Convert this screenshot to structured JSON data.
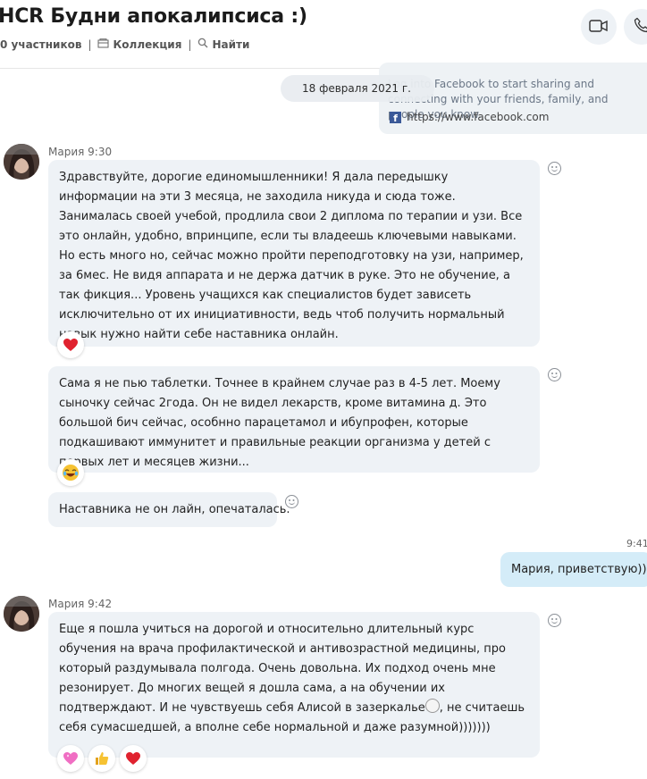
{
  "header": {
    "title": "HCR Будни апокалипсиса :)",
    "participants": "0 участников",
    "collection": "Коллекция",
    "find": "Найти"
  },
  "link_preview": {
    "description": "Log into Facebook to start sharing and connecting with your friends, family, and people you know.",
    "url": "https://www.facebook.com"
  },
  "date_separator": "18 февраля 2021 г.",
  "messages": [
    {
      "sender": "Мария 9:30",
      "text": "Здравствуйте, дорогие единомышленники! Я дала передышку информации на эти 3 месяца, не заходила никуда и сюда тоже. Занималась своей учебой, продлила свои 2 диплома по терапии и узи. Все это онлайн, удобно, впринципе, если ты владеешь ключевыми навыками. Но есть много но, сейчас можно пройти переподготовку на узи, например, за 6мес. Не видя аппарата и не держа датчик в руке. Это не обучение, а так фикция... Уровень учащихся как специалистов будет зависеть исключительно от их инициативности, ведь чтоб получить нормальный навык нужно найти себе наставника онлайн.",
      "reactions": [
        "heart"
      ]
    },
    {
      "text": "Сама я не пью таблетки. Точнее в крайнем случае раз в 4-5 лет. Моему сыночку сейчас 2года. Он  не видел лекарств, кроме витамина д. Это большой бич сейчас, особнно парацетамол и ибупрофен, которые подкашивают иммунитет и правильные реакции организма у детей с первых лет и месяцев жизни...",
      "reactions": [
        "laughing-face"
      ]
    },
    {
      "text": "Наставника не он лайн, опечаталась."
    },
    {
      "time": "9:41",
      "text": "Мария, приветствую)))"
    },
    {
      "sender": "Мария 9:42",
      "text_before": "Еще я пошла учиться на дорогой и  относительно длительный курс обучения на врача профилактической и антивозрастной медицины, про который раздумывала полгода. Очень довольна. Их подход очень мне резонирует. До многих вещей я дошла сама, а на обучении их подтверждают. И не чувствуешь себя Алисой в зазеркалье",
      "text_after": ", не считаешь себя сумасшедшей, а вполне себе нормальной и даже разумной)))))))",
      "reactions": [
        "sparkling-heart",
        "thumbs-up",
        "heart"
      ]
    }
  ],
  "icons": {
    "heart": "❤",
    "thumbs": "👍",
    "sparkle_heart": "💖",
    "laugh": "😂",
    "video": "video-camera-icon",
    "phone": "phone-icon"
  },
  "colors": {
    "incoming_bubble": "#eef2f6",
    "outgoing_bubble": "#d4ecf8",
    "heart": "#e0222f"
  }
}
